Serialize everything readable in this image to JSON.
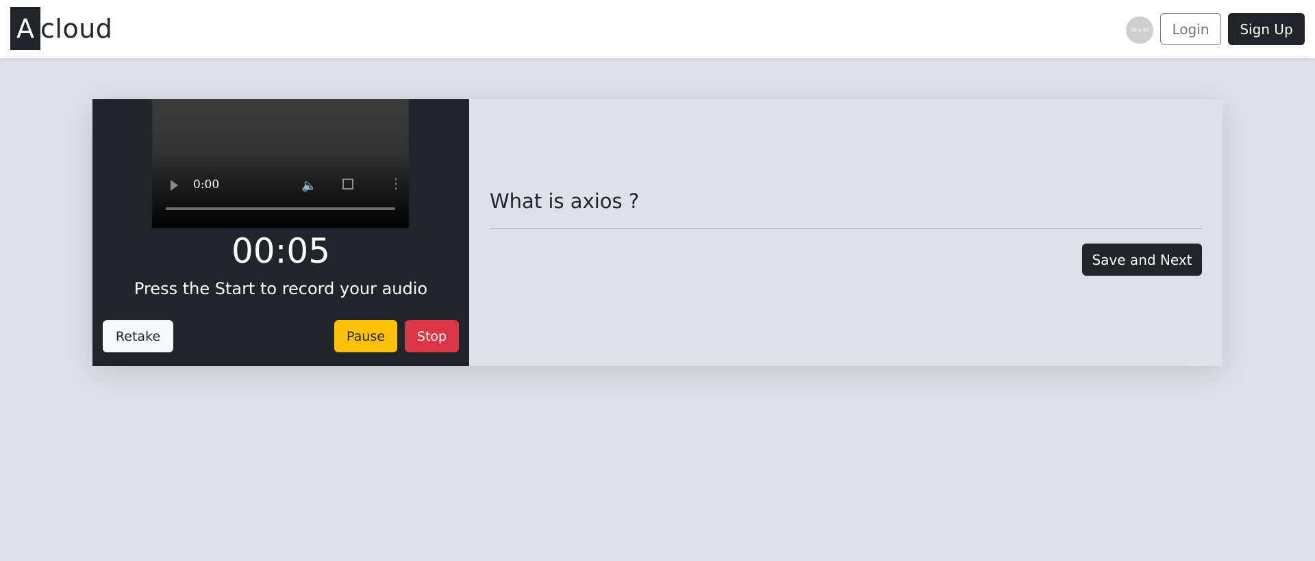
{
  "navbar": {
    "brand_letter": "A",
    "brand_rest": "cloud",
    "avatar_text": "32 x 32",
    "login_label": "Login",
    "signup_label": "Sign Up"
  },
  "recorder": {
    "video_time": "0:00",
    "timer": "00:05",
    "instruction": "Press the Start to record your audio",
    "retake_label": "Retake",
    "pause_label": "Pause",
    "stop_label": "Stop"
  },
  "question": {
    "text": "What is axios ?",
    "save_next_label": "Save and Next"
  },
  "colors": {
    "dark": "#212529",
    "warning": "#ffc107",
    "danger": "#dc3545",
    "background": "#dee1e6"
  }
}
